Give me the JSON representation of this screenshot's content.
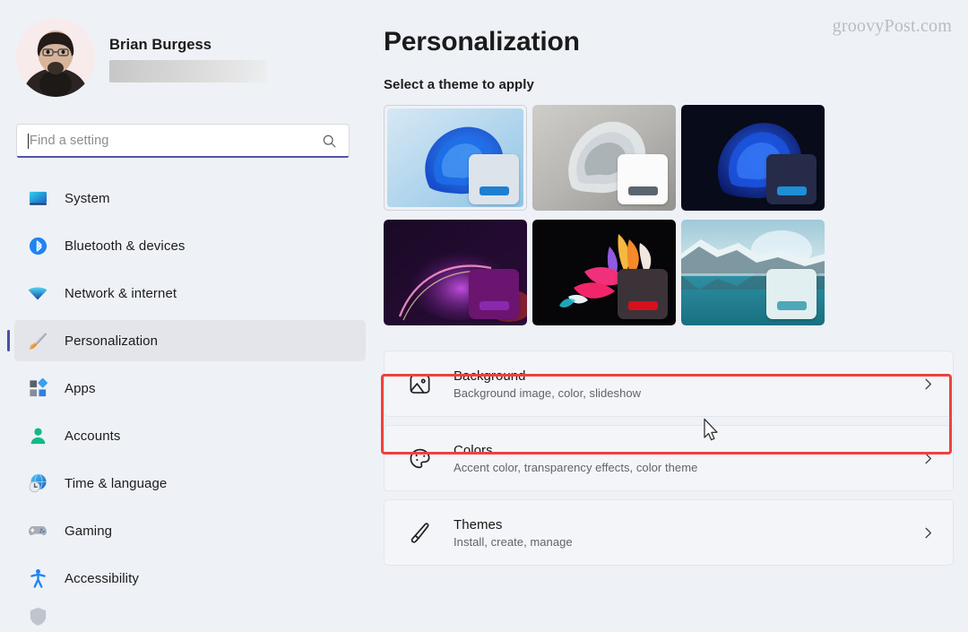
{
  "window": {
    "app": "Settings"
  },
  "sidebar": {
    "profile": {
      "name": "Brian Burgess",
      "email_redacted": true
    },
    "search": {
      "placeholder": "Find a setting",
      "value": "",
      "icon": "search-icon"
    },
    "items": [
      {
        "label": "System",
        "icon": "display-monitor-icon",
        "selected": false
      },
      {
        "label": "Bluetooth & devices",
        "icon": "bluetooth-icon",
        "selected": false
      },
      {
        "label": "Network & internet",
        "icon": "wifi-icon",
        "selected": false
      },
      {
        "label": "Personalization",
        "icon": "paintbrush-icon",
        "selected": true
      },
      {
        "label": "Apps",
        "icon": "apps-grid-icon",
        "selected": false
      },
      {
        "label": "Accounts",
        "icon": "person-icon",
        "selected": false
      },
      {
        "label": "Time & language",
        "icon": "clock-globe-icon",
        "selected": false
      },
      {
        "label": "Gaming",
        "icon": "gamepad-icon",
        "selected": false
      },
      {
        "label": "Accessibility",
        "icon": "accessibility-icon",
        "selected": false
      },
      {
        "label": "",
        "icon": "privacy-shield-icon",
        "selected": false
      }
    ]
  },
  "main": {
    "watermark": "groovyPost.com",
    "title": "Personalization",
    "theme_section_label": "Select a theme to apply",
    "themes": [
      {
        "name": "Windows light bloom",
        "selected": true,
        "bg_from": "#cfe3f0",
        "bg_to": "#8fc4e6",
        "bloom": "#1a6fe0",
        "win_bg": "#dde3ea",
        "win_bar": "#1e7fd0"
      },
      {
        "name": "Windows light grey",
        "selected": false,
        "bg_from": "#c9c9c6",
        "bg_to": "#9d9c99",
        "bloom": "#e2e6e9",
        "win_bg": "#fbfbfb",
        "win_bar": "#5b6570"
      },
      {
        "name": "Windows dark bloom",
        "selected": false,
        "bg_from": "#090d1c",
        "bg_to": "#0a1026",
        "bloom": "#1b4fd8",
        "win_bg": "#262b4a",
        "win_bar": "#1e8fd6"
      },
      {
        "name": "Glow dark purple",
        "selected": false,
        "bg_from": "#1c0a2a",
        "bg_to": "#3a0f4e",
        "bloom": "#9a27b8",
        "win_bg": "#6b1570",
        "win_bar": "#8a28b0"
      },
      {
        "name": "Flow flower dark",
        "selected": false,
        "bg_from": "#060606",
        "bg_to": "#0b0508",
        "bloom": "#f0457a",
        "win_bg": "#3b3338",
        "win_bar": "#d8101c"
      },
      {
        "name": "Captured motion lake",
        "selected": false,
        "bg_from": "#b4d6e2",
        "bg_to": "#2f8a9c",
        "bloom": "#eaf6f8",
        "win_bg": "#e2eff0",
        "win_bar": "#4fa8b8"
      }
    ],
    "rows": [
      {
        "title": "Background",
        "desc": "Background image, color, slideshow",
        "icon": "picture-icon",
        "chevron": "chevron-right-icon",
        "highlighted": true
      },
      {
        "title": "Colors",
        "desc": "Accent color, transparency effects, color theme",
        "icon": "palette-icon",
        "chevron": "chevron-right-icon",
        "highlighted": false
      },
      {
        "title": "Themes",
        "desc": "Install, create, manage",
        "icon": "paintbrush-outline-icon",
        "chevron": "chevron-right-icon",
        "highlighted": false
      }
    ]
  },
  "annotations": {
    "highlight_color": "#f0413f",
    "accent_color": "#4b4ea8",
    "cursor": "arrow-pointer"
  }
}
